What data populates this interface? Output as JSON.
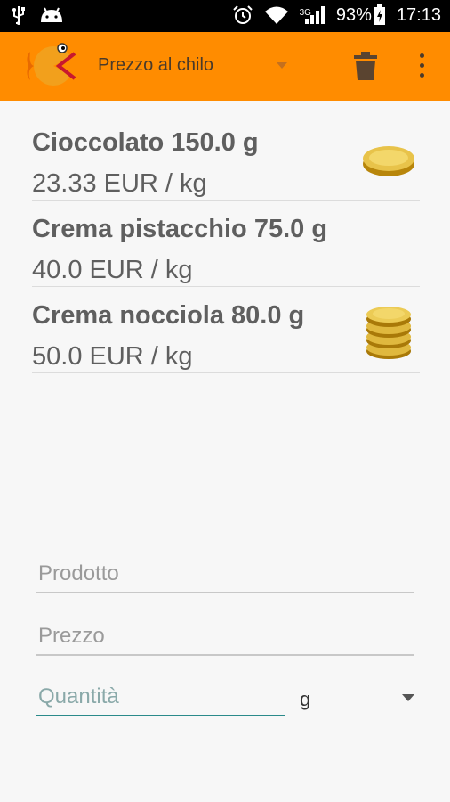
{
  "status": {
    "battery": "93%",
    "time": "17:13",
    "network": "3G"
  },
  "actionbar": {
    "title": "Prezzo al chilo",
    "trash_icon": "trash-icon",
    "overflow_icon": "overflow-menu-icon",
    "color": "#ff8c00"
  },
  "items": [
    {
      "name": "Cioccolato 150.0 g",
      "price": "23.33 EUR / kg",
      "badge": "single-coin-icon"
    },
    {
      "name": "Crema pistacchio 75.0 g",
      "price": "40.0 EUR / kg",
      "badge": ""
    },
    {
      "name": "Crema nocciola 80.0 g",
      "price": "50.0 EUR / kg",
      "badge": "coin-stack-icon"
    }
  ],
  "form": {
    "product_placeholder": "Prodotto",
    "price_placeholder": "Prezzo",
    "quantity_placeholder": "Quantità",
    "unit_selected": "g"
  }
}
